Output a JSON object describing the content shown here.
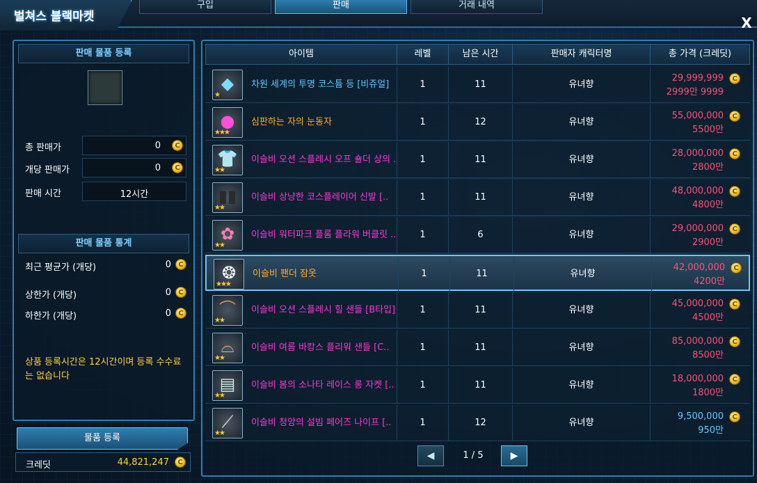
{
  "window": {
    "title": "벌쳐스 블랙마켓",
    "close_label": "X"
  },
  "tabs": [
    {
      "label": "구입",
      "active": false
    },
    {
      "label": "판매",
      "active": true
    },
    {
      "label": "거래 내역",
      "active": false
    }
  ],
  "sell_register": {
    "header": "판매 물품 등록",
    "total_price_label": "총 판매가",
    "total_price_value": "0",
    "unit_price_label": "개당 판매가",
    "unit_price_value": "0",
    "sell_time_label": "판매 시간",
    "sell_time_value": "12시간"
  },
  "sell_stats": {
    "header": "판매 물품 통계",
    "recent_avg_label": "최근 평균가 (개당)",
    "recent_avg_value": "0",
    "upper_label": "상한가 (개당)",
    "upper_value": "0",
    "lower_label": "하한가 (개당)",
    "lower_value": "0"
  },
  "notice": "상품 등록시간은 12시간이며 등록 수수료는 없습니다",
  "register_button": "물품 등록",
  "credit": {
    "label": "크레딧",
    "value": "44,821,247"
  },
  "table": {
    "columns": [
      "아이템",
      "레벨",
      "남은 시간",
      "판매자 캐릭터명",
      "총 가격 (크레딧)"
    ],
    "rows": [
      {
        "name": "차원 세계의 투명 코스튬 등 [비쥬얼]",
        "name_color": "#5ec8ff",
        "icon": "crystal-icon",
        "glyph": "◆",
        "glyph_color": "#7fdcff",
        "stars": "★",
        "level": "1",
        "time": "11",
        "seller": "유녀향",
        "price": "29,999,999",
        "price_short": "2999만 9999",
        "price_color": "#ff4f7a",
        "selected": false
      },
      {
        "name": "심판하는 자의 눈동자",
        "name_color": "#ffb020",
        "icon": "eye-orb-icon",
        "glyph": "●",
        "glyph_color": "#ff4fd8",
        "stars": "★★★",
        "level": "1",
        "time": "12",
        "seller": "유녀향",
        "price": "55,000,000",
        "price_short": "5500만",
        "price_color": "#ff4f7a",
        "selected": false
      },
      {
        "name": "이슬비 오션 스플레시 오프 숄더 상의 ..",
        "name_color": "#ff36d6",
        "icon": "top-costume-icon",
        "glyph": "👕",
        "glyph_color": "#ffffff",
        "stars": "★★",
        "level": "1",
        "time": "11",
        "seller": "유녀향",
        "price": "28,000,000",
        "price_short": "2800만",
        "price_color": "#ff4f7a",
        "selected": false
      },
      {
        "name": "이슬비 상냥한 코스플레이어 신발 [..",
        "name_color": "#ff36d6",
        "icon": "shoes-icon",
        "glyph": "▮▮",
        "glyph_color": "#2a2a2a",
        "stars": "★★",
        "level": "1",
        "time": "11",
        "seller": "유녀향",
        "price": "48,000,000",
        "price_short": "4800만",
        "price_color": "#ff4f7a",
        "selected": false
      },
      {
        "name": "이슬비 워터파크 플롬 플라워 버클릿 ..",
        "name_color": "#ff36d6",
        "icon": "flower-icon",
        "glyph": "✿",
        "glyph_color": "#ff7fb0",
        "stars": "★★",
        "level": "1",
        "time": "6",
        "seller": "유녀향",
        "price": "29,000,000",
        "price_short": "2900만",
        "price_color": "#ff4f7a",
        "selected": false
      },
      {
        "name": "이슬비 팬더 잠옷",
        "name_color": "#ffb020",
        "icon": "panda-icon",
        "glyph": "❂",
        "glyph_color": "#ffffff",
        "stars": "★★★",
        "level": "1",
        "time": "11",
        "seller": "유녀향",
        "price": "42,000,000",
        "price_short": "4200만",
        "price_color": "#ff4f7a",
        "selected": true
      },
      {
        "name": "이슬비 오션 스플레시 힐 샌들 [B타입]",
        "name_color": "#ff36d6",
        "icon": "sandals-icon",
        "glyph": "⌒",
        "glyph_color": "#d08a5a",
        "stars": "★★",
        "level": "1",
        "time": "11",
        "seller": "유녀향",
        "price": "45,000,000",
        "price_short": "4500만",
        "price_color": "#ff4f7a",
        "selected": false
      },
      {
        "name": "이슬비 여름 바캉스 플리워 샌들 [C..",
        "name_color": "#ff36d6",
        "icon": "summer-sandals-icon",
        "glyph": "⌓",
        "glyph_color": "#e8b090",
        "stars": "★★",
        "level": "1",
        "time": "11",
        "seller": "유녀향",
        "price": "85,000,000",
        "price_short": "8500만",
        "price_color": "#ff4f7a",
        "selected": false
      },
      {
        "name": "이슬비 봄의 소나타 레이스 롱 자켓 [..",
        "name_color": "#ff36d6",
        "icon": "jacket-icon",
        "glyph": "▤",
        "glyph_color": "#cfe8e0",
        "stars": "★★",
        "level": "1",
        "time": "11",
        "seller": "유녀향",
        "price": "18,000,000",
        "price_short": "1800만",
        "price_color": "#ff4f7a",
        "selected": false
      },
      {
        "name": "이슬비 청양의 설빔 페어즈 나이프 [..",
        "name_color": "#ff36d6",
        "icon": "knife-icon",
        "glyph": "⟋",
        "glyph_color": "#e0e0e0",
        "stars": "★★",
        "level": "1",
        "time": "12",
        "seller": "유녀향",
        "price": "9,500,000",
        "price_short": "950만",
        "price_color": "#6ec6ff",
        "selected": false
      }
    ]
  },
  "pagination": {
    "text": "1 / 5",
    "prev_label": "◀",
    "next_label": "▶"
  },
  "colors": {
    "accent": "#2d7fb3",
    "header_text": "#7fd0ff",
    "notice": "#ffd23c"
  }
}
